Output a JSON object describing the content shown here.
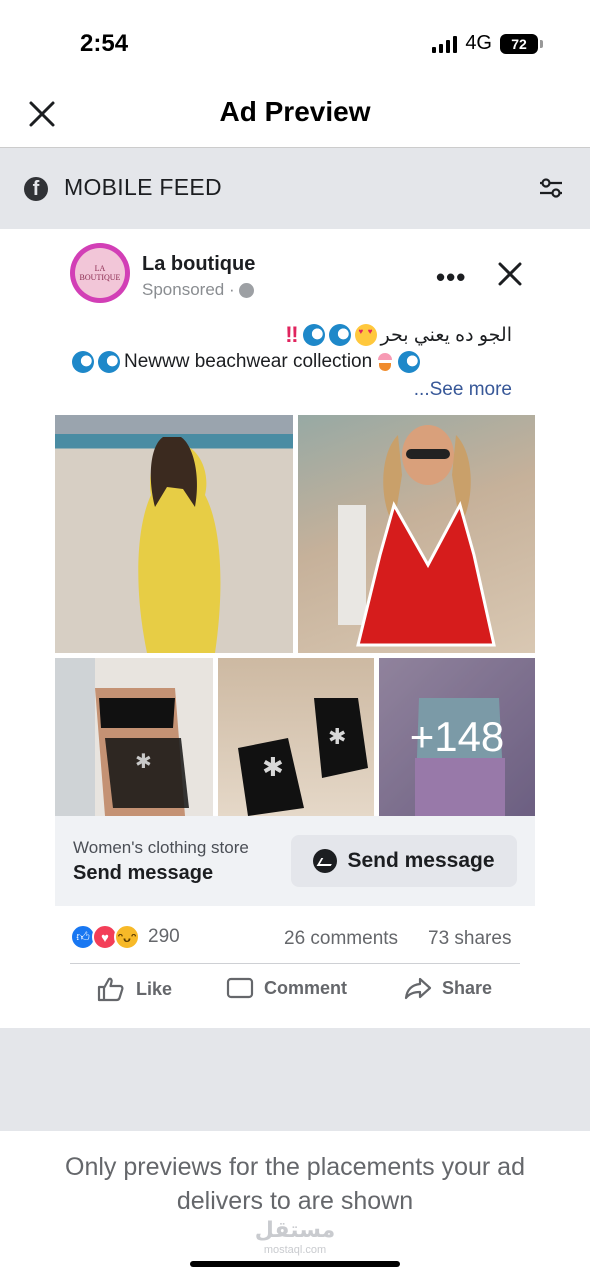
{
  "status_bar": {
    "time": "2:54",
    "network": "4G",
    "battery": "72"
  },
  "header": {
    "title": "Ad Preview"
  },
  "placement": {
    "label": "MOBILE FEED"
  },
  "post": {
    "avatar_text": "LA BOUTIQUE",
    "page_name": "La boutique",
    "sponsored": "Sponsored ·",
    "caption_ar": "الجو ده يعني بحر",
    "caption_en": "Newww beachwear collection",
    "see_more": "...See more",
    "more_photos": "+148"
  },
  "cta": {
    "subtitle": "Women's clothing store",
    "title": "Send message",
    "button_label": "Send message"
  },
  "engagement": {
    "reactions_count": "290",
    "comments": "26 comments",
    "shares": "73 shares"
  },
  "actions": {
    "like": "Like",
    "comment": "Comment",
    "share": "Share"
  },
  "footer_note": "Only previews for the placements your ad delivers to are shown",
  "watermark": {
    "arabic": "مستقل",
    "latin": "mostaql.com"
  },
  "icons": [
    "close-icon",
    "facebook-icon",
    "filter-icon",
    "more-icon",
    "messenger-icon",
    "like-icon",
    "comment-icon",
    "share-icon"
  ]
}
